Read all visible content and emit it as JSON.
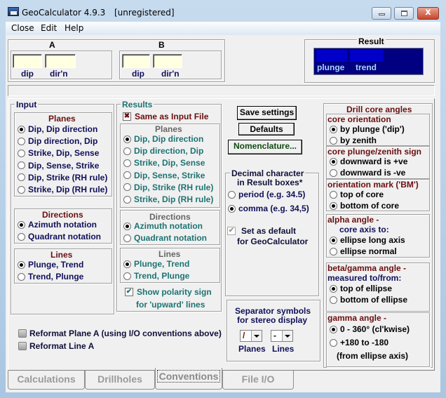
{
  "window": {
    "title": "GeoCalculator 4.9.3",
    "status": "[unregistered]",
    "controls": {
      "minimize": "minimize",
      "maximize": "maximize",
      "close": "x"
    }
  },
  "menu": [
    "Close",
    "Edit",
    "Help"
  ],
  "inputs": {
    "a": {
      "label": "A",
      "fields": [
        {
          "label": "dip",
          "value": ""
        },
        {
          "label": "dir'n",
          "value": ""
        }
      ]
    },
    "b": {
      "label": "B",
      "fields": [
        {
          "label": "dip",
          "value": ""
        },
        {
          "label": "dir'n",
          "value": ""
        }
      ]
    }
  },
  "result": {
    "label": "Result",
    "fields": [
      {
        "label": "plunge",
        "value": ""
      },
      {
        "label": "trend",
        "value": ""
      }
    ]
  },
  "input_group": {
    "title": "Input",
    "planes": {
      "title": "Planes",
      "selected": 0,
      "options": [
        "Dip,  Dip direction",
        "Dip direction, Dip",
        "Strike, Dip, Sense",
        "Dip,  Sense,  Strike",
        "Dip, Strike (RH rule)",
        "Strike, Dip (RH rule)"
      ]
    },
    "directions": {
      "title": "Directions",
      "selected": 0,
      "options": [
        "Azimuth notation",
        "Quadrant notation"
      ]
    },
    "lines": {
      "title": "Lines",
      "selected": 0,
      "options": [
        "Plunge, Trend",
        "Trend, Plunge"
      ]
    }
  },
  "results_group": {
    "title": "Results",
    "same_as_input": {
      "label": "Same as Input File",
      "checked": true
    },
    "planes": {
      "title": "Planes",
      "selected": 0,
      "options": [
        "Dip,  Dip direction",
        "Dip direction, Dip",
        "Strike, Dip, Sense",
        "Dip,  Sense,  Strike",
        "Dip, Strike (RH rule)",
        "Strike, Dip (RH rule)"
      ]
    },
    "directions": {
      "title": "Directions",
      "selected": 0,
      "options": [
        "Azimuth notation",
        "Quadrant notation"
      ]
    },
    "lines": {
      "title": "Lines",
      "selected": 0,
      "options": [
        "Plunge, Trend",
        "Trend, Plunge"
      ]
    },
    "polarity": {
      "label_1": "Show polarity sign",
      "label_2": "for 'upward' lines",
      "checked": true
    }
  },
  "buttons": {
    "save": "Save settings",
    "defaults": "Defaults",
    "nomenclature": "Nomenclature..."
  },
  "decimal": {
    "title_1": "Decimal character",
    "title_2": "in Result boxes*",
    "selected": 1,
    "options": [
      "period  (e.g. 34.5)",
      "comma (e.g. 34,5)"
    ],
    "set_default": {
      "label_1": "Set as default",
      "label_2": "for GeoCalculator",
      "checked": true
    }
  },
  "separator": {
    "title_1": "Separator symbols",
    "title_2": "for stereo display",
    "planes": {
      "label": "Planes",
      "value": "/"
    },
    "lines": {
      "label": "Lines",
      "value": "-"
    }
  },
  "drill": {
    "title": "Drill core angles",
    "core_orientation": {
      "title": "core orientation",
      "selected": 0,
      "options": [
        "by plunge ('dip')",
        "by zenith"
      ]
    },
    "sign": {
      "title": "core plunge/zenith sign",
      "selected": 0,
      "options": [
        "downward is +ve",
        "downward is -ve"
      ]
    },
    "mark": {
      "title": "orientation mark ('BM')",
      "selected": 1,
      "options": [
        "top of core",
        "bottom of core"
      ]
    },
    "alpha": {
      "title": "alpha angle -",
      "subtitle": "core axis to:",
      "selected": 0,
      "options": [
        "ellipse long axis",
        "ellipse normal"
      ]
    },
    "beta": {
      "title": "beta/gamma angle -",
      "subtitle": "measured to/from:",
      "selected": 0,
      "options": [
        "top of ellipse",
        "bottom of ellipse"
      ]
    },
    "gamma": {
      "title": "gamma angle -",
      "selected": 0,
      "options": [
        "0 - 360° (cl'kwise)",
        "+180 to -180"
      ],
      "note": "(from ellipse axis)"
    }
  },
  "reformat": {
    "plane": "Reformat Plane A  (using I/O conventions above)",
    "line": "Reformat Line A"
  },
  "tabs": [
    {
      "label": "Calculations",
      "active": false
    },
    {
      "label": "Drillholes",
      "active": false
    },
    {
      "label": "Conventions",
      "active": true
    },
    {
      "label": "File I/O",
      "active": false
    }
  ]
}
